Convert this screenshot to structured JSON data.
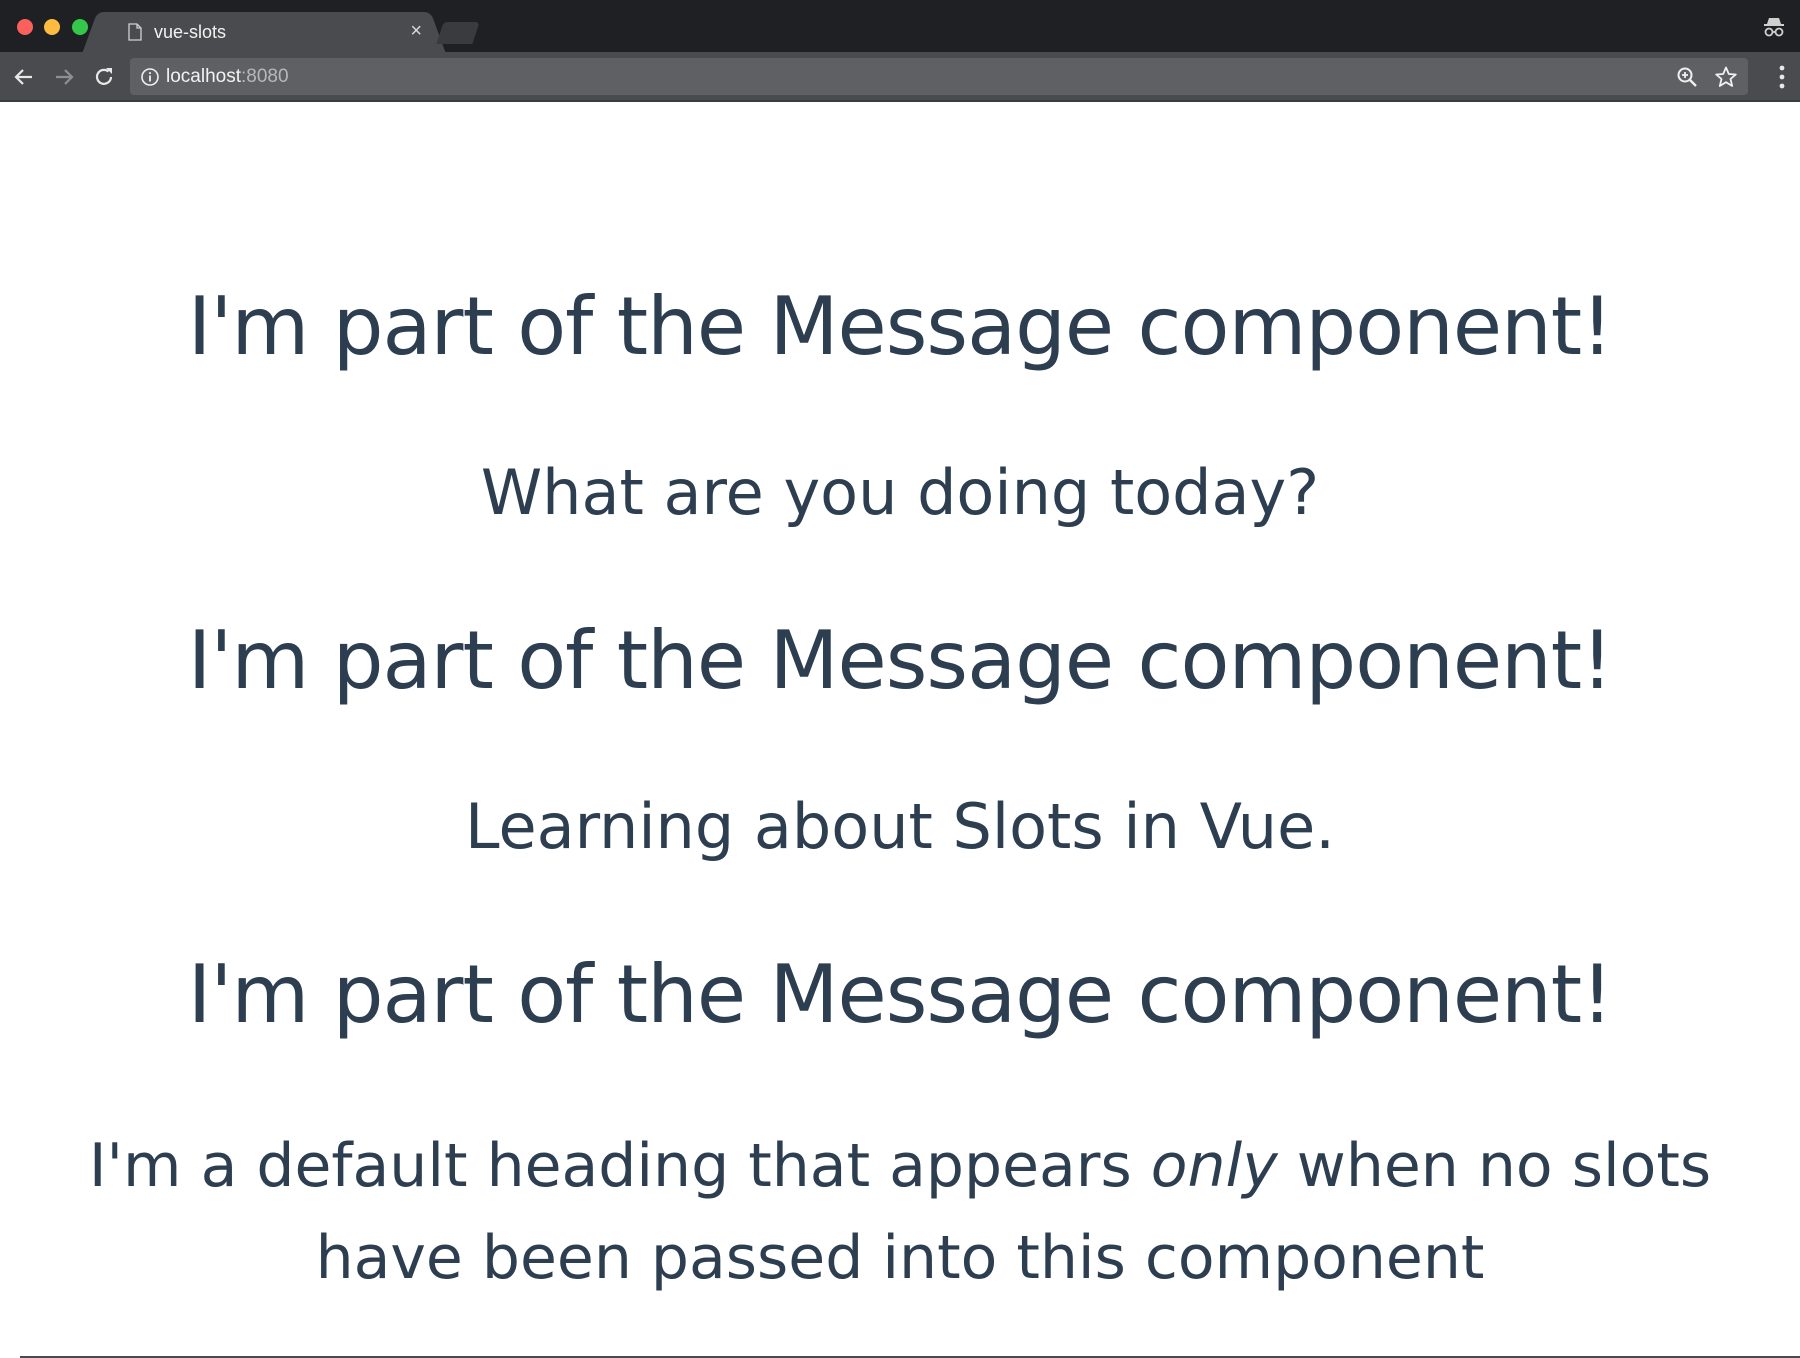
{
  "browser": {
    "tab": {
      "title": "vue-slots",
      "close_label": "×"
    },
    "address_bar": {
      "host": "localhost",
      "port": ":8080"
    }
  },
  "page": {
    "blocks": [
      {
        "heading": "I'm part of the Message component!",
        "text": "What are you doing today?"
      },
      {
        "heading": "I'm part of the Message component!",
        "text": "Learning about Slots in Vue."
      },
      {
        "heading": "I'm part of the Message component!"
      }
    ],
    "default_heading": {
      "before": "I'm a default heading that appears ",
      "emphasis": "only",
      "after": " when no slots",
      "line2": "have been passed into this component"
    }
  },
  "colors": {
    "text": "#2c3e50",
    "chrome_dark": "#1f2023",
    "chrome_toolbar": "#4a4b4e"
  },
  "icons": {
    "tab": "page-icon",
    "nav": [
      "back-arrow-icon",
      "forward-arrow-icon",
      "reload-icon"
    ],
    "omnibox": [
      "info-icon",
      "zoom-icon",
      "star-icon"
    ],
    "window": [
      "incognito-icon",
      "menu-dots-icon"
    ]
  }
}
